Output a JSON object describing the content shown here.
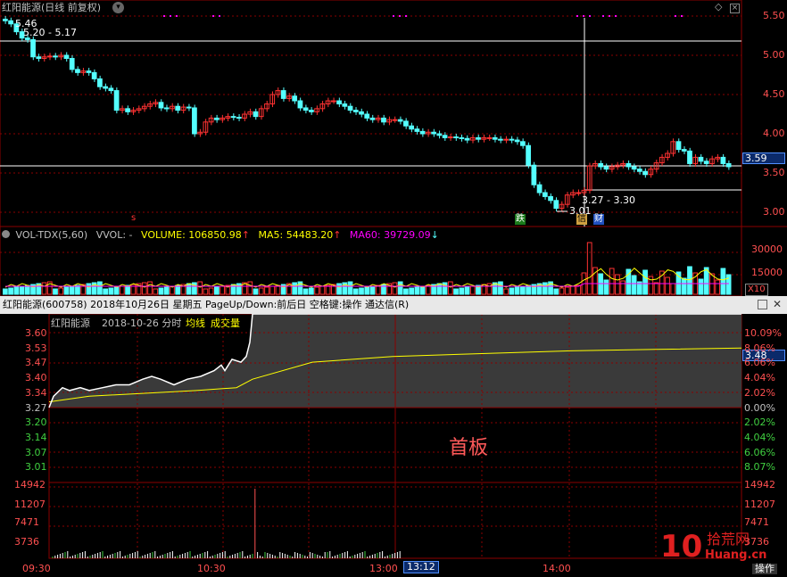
{
  "kline": {
    "title": "红阳能源(日线 前复权)",
    "y_ticks": [
      "5.50",
      "5.00",
      "4.50",
      "4.00",
      "3.50",
      "3.00"
    ],
    "current_price": "3.59",
    "high_label": "5.46",
    "range_label_1": "5.20 - 5.17",
    "range_label_2": "3.27 - 3.30",
    "low_label": "3.01",
    "marker_die": "跌",
    "marker_xin": "信",
    "marker_cai": "财",
    "marker_s": "s"
  },
  "volume": {
    "name": "VOL-TDX(5,60)",
    "vvol": "VVOL: -",
    "volume_label": "VOLUME: 106850.98",
    "ma5_label": "MA5: 54483.20",
    "ma60_label": "MA60: 39729.09",
    "y_ticks": [
      "30000",
      "15000"
    ],
    "unit": "X10"
  },
  "intraday": {
    "header": "红阳能源(600758)  2018年10月26日 星期五  PageUp/Down:前后日  空格键:操作  通达信(R)",
    "stock_name": "红阳能源",
    "date_label": "2018-10-26 分时",
    "avg_label": "均线",
    "vol_label": "成交量",
    "left_price_ticks": [
      "3.60",
      "3.53",
      "3.47",
      "3.40",
      "3.34",
      "3.27",
      "3.20",
      "3.14",
      "3.07",
      "3.01"
    ],
    "right_pct_ticks": [
      "10.09%",
      "8.06%",
      "6.06%",
      "4.04%",
      "2.02%",
      "0.00%",
      "2.02%",
      "4.04%",
      "6.06%",
      "8.07%"
    ],
    "current_price": "3.48",
    "vol_ticks": [
      "14942",
      "11207",
      "7471",
      "3736"
    ],
    "time_ticks": [
      "09:30",
      "10:30",
      "13:00",
      "14:00"
    ],
    "cursor_time": "13:12",
    "overlay_text": "首板",
    "action_label": "操作"
  },
  "watermark": {
    "logo_number": "10",
    "site_cn": "拾荒网",
    "site_en": "Huang.cn"
  },
  "colors": {
    "up": "#ff3232",
    "down": "#54ffff",
    "ma5": "#ffff00",
    "ma60": "#ff00ff",
    "grid": "#8b0000"
  }
}
